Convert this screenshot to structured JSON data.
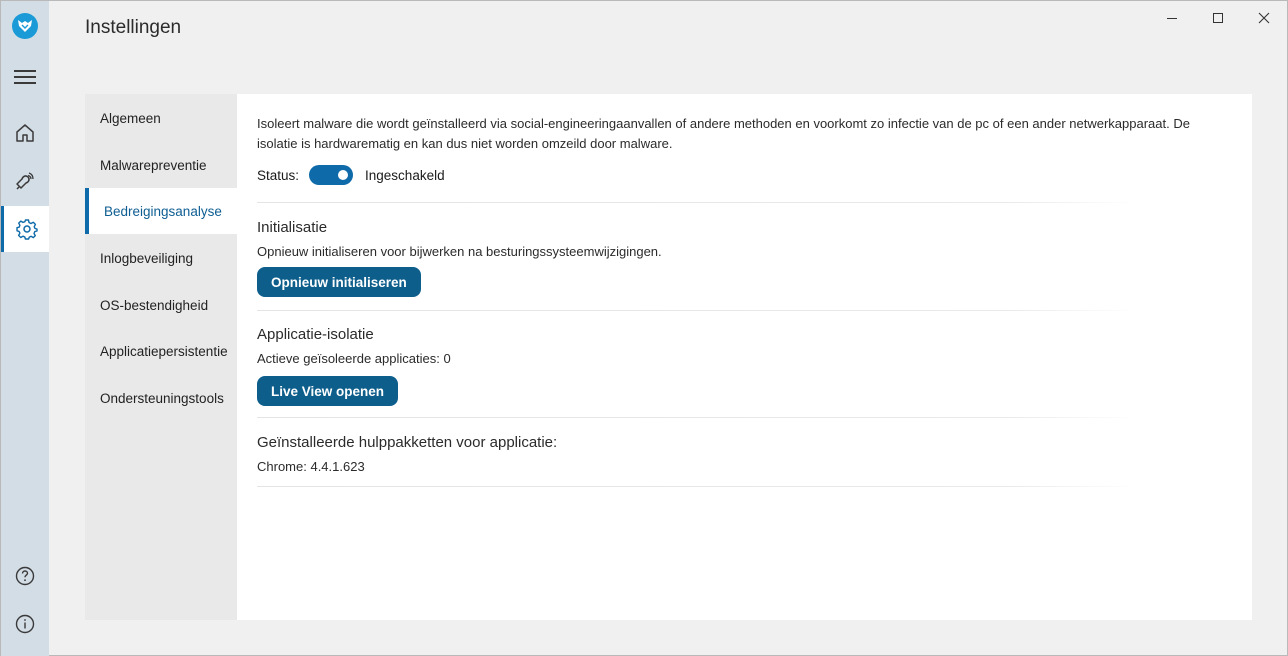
{
  "window": {
    "title": "Instellingen",
    "controls": [
      "minimize-icon",
      "maximize-icon",
      "close-icon"
    ]
  },
  "rail": {
    "items": [
      {
        "icon": "hamburger-menu-icon"
      },
      {
        "icon": "home-icon"
      },
      {
        "icon": "alerts-icon"
      },
      {
        "icon": "gear-icon",
        "active": true
      },
      {
        "icon": "help-icon"
      },
      {
        "icon": "info-icon"
      }
    ]
  },
  "nav": {
    "items": [
      {
        "label": "Algemeen"
      },
      {
        "label": "Malwarepreventie"
      },
      {
        "label": "Bedreigingsanalyse",
        "active": true
      },
      {
        "label": "Inlogbeveiliging"
      },
      {
        "label": "OS-bestendigheid"
      },
      {
        "label": "Applicatiepersistentie"
      },
      {
        "label": "Ondersteuningstools"
      }
    ]
  },
  "content": {
    "description": "Isoleert malware die wordt geïnstalleerd via social-engineeringaanvallen of andere methoden en voorkomt zo infectie van de pc of een ander netwerkapparaat. De isolatie is hardwarematig en kan dus niet worden omzeild door malware.",
    "status": {
      "label": "Status:",
      "enabled": true,
      "value": "Ingeschakeld"
    },
    "initialisatie": {
      "title": "Initialisatie",
      "text": "Opnieuw initialiseren voor bijwerken na besturingssysteemwijzigingen.",
      "button": "Opnieuw initialiseren"
    },
    "isolatie": {
      "title": "Applicatie-isolatie",
      "text": "Actieve geïsoleerde applicaties: 0",
      "button": "Live View openen"
    },
    "hulppakketten": {
      "title": "Geïnstalleerde hulppakketten voor applicatie:",
      "text": "Chrome: 4.4.1.623"
    }
  },
  "colors": {
    "accent": "#0e6aa8",
    "button": "#0e5e8c",
    "rail": "#d3dde6",
    "logo": "#1a9ad6"
  }
}
